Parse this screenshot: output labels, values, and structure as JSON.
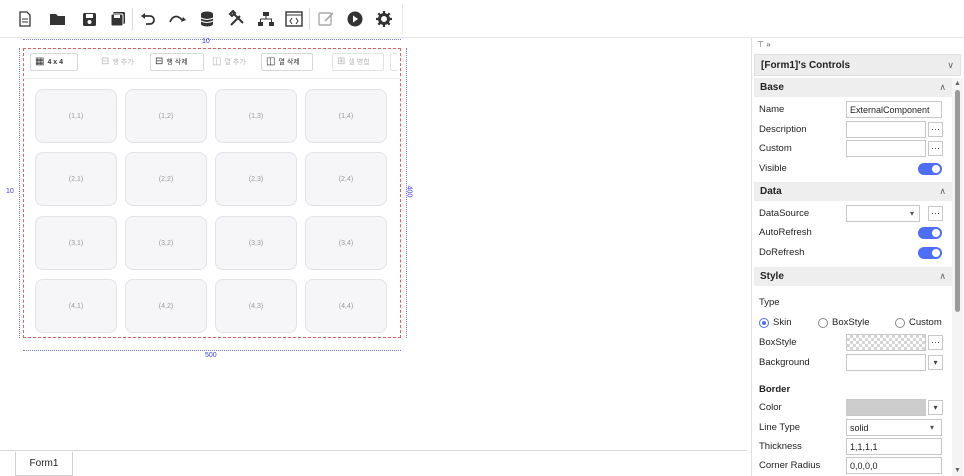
{
  "toolbar": {
    "icons": [
      "new-file-icon",
      "open-folder-icon",
      "save-icon",
      "save-all-icon",
      "undo-icon",
      "redo-icon",
      "database-icon",
      "tools-icon",
      "hierarchy-icon",
      "code-icon",
      "edit-icon",
      "run-icon",
      "settings-icon"
    ]
  },
  "designer": {
    "top_margin": "10",
    "left_margin": "10",
    "width": "500",
    "height": "400",
    "grid_tools": {
      "size": "4 x 4",
      "add_row": "행 추가",
      "delete_row": "행 삭제",
      "add_column": "열 추가",
      "delete_column": "열 삭제",
      "merge_cells": "셀 병합"
    },
    "cells": [
      [
        "(1,1)",
        "(1,2)",
        "(1,3)",
        "(1,4)"
      ],
      [
        "(2,1)",
        "(2,2)",
        "(2,3)",
        "(2,4)"
      ],
      [
        "(3,1)",
        "(3,2)",
        "(3,3)",
        "(3,4)"
      ],
      [
        "(4,1)",
        "(4,2)",
        "(4,3)",
        "(4,4)"
      ]
    ]
  },
  "tabs": {
    "form1": "Form1"
  },
  "panel": {
    "pin": "⊤ »",
    "controls_title": "[Form1]'s Controls",
    "sections": {
      "base": "Base",
      "data": "Data",
      "style": "Style",
      "border": "Border"
    },
    "props": {
      "name_label": "Name",
      "name_value": "ExternalComponent",
      "description_label": "Description",
      "custom_label": "Custom",
      "visible_label": "Visible",
      "datasource_label": "DataSource",
      "autorefresh_label": "AutoRefresh",
      "dorefresh_label": "DoRefresh",
      "type_label": "Type",
      "skin_option": "Skin",
      "boxstyle_option": "BoxStyle",
      "custom_option": "Custom",
      "boxstyle_label": "BoxStyle",
      "background_label": "Background",
      "color_label": "Color",
      "linetype_label": "Line Type",
      "linetype_value": "solid",
      "thickness_label": "Thickness",
      "thickness_value": "1,1,1,1",
      "corner_label": "Corner Radius",
      "corner_value": "0,0,0,0"
    },
    "selected_type": "Skin",
    "colors": {
      "toggle_on": "#4f6ef7",
      "border_color_value": "#cccccc",
      "form_border": "#e06060"
    }
  }
}
